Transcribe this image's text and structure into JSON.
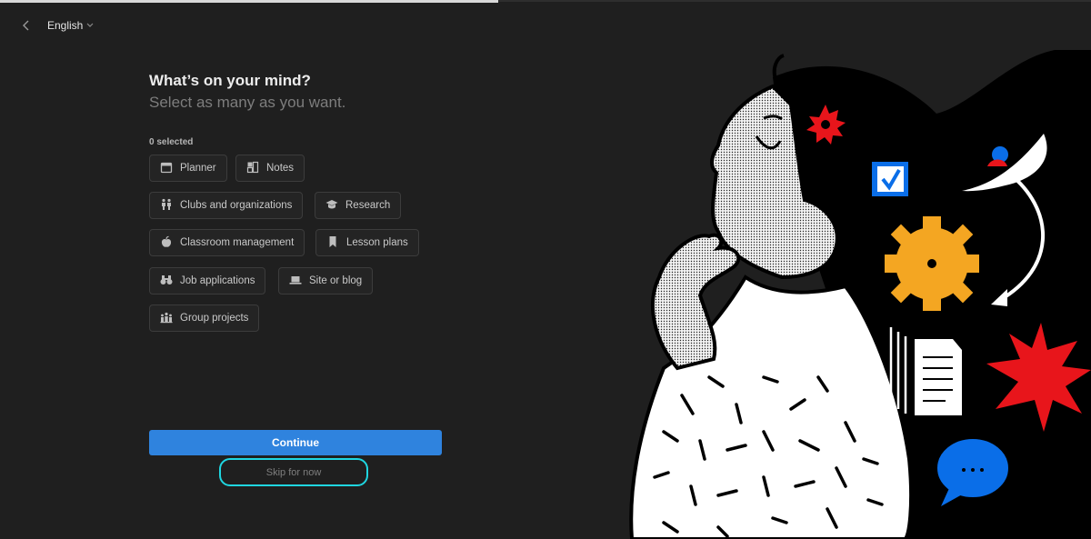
{
  "header": {
    "language": "English"
  },
  "main": {
    "title": "What’s on your mind?",
    "subtitle": "Select as many as you want.",
    "selected_count": "0 selected",
    "options": [
      {
        "label": "Planner",
        "icon": "calendar-icon"
      },
      {
        "label": "Notes",
        "icon": "notes-icon"
      },
      {
        "label": "Clubs and organizations",
        "icon": "people-icon"
      },
      {
        "label": "Research",
        "icon": "graduation-cap-icon"
      },
      {
        "label": "Classroom management",
        "icon": "apple-icon"
      },
      {
        "label": "Lesson plans",
        "icon": "bookmark-icon"
      },
      {
        "label": "Job applications",
        "icon": "binoculars-icon"
      },
      {
        "label": "Site or blog",
        "icon": "laptop-icon"
      },
      {
        "label": "Group projects",
        "icon": "group-icon"
      }
    ],
    "continue_label": "Continue",
    "skip_label": "Skip for now"
  },
  "colors": {
    "background": "#1f1f1f",
    "accent": "#2f83de",
    "focus_ring": "#1fd6e0"
  }
}
